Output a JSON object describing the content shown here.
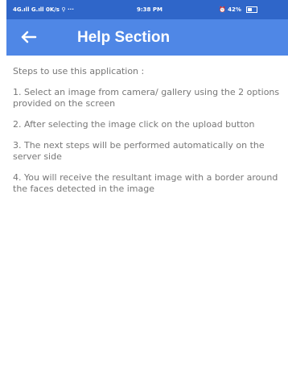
{
  "status_bar": {
    "left": "4G.ıll G.ıll 0K/s ⚲ ··· ",
    "time": "9:38 PM",
    "right": "⏰ 42%"
  },
  "app_bar": {
    "title": "Help Section",
    "back_icon": "arrow-left-icon"
  },
  "content": {
    "intro": "Steps to use this application :",
    "steps": [
      "1. Select an image from camera/ gallery using the 2 options provided on the screen",
      "2. After selecting the image click on the upload button",
      "3. The next steps will be performed automatically on the server side",
      "4. You will receive the resultant image with a border around the faces detected in the image"
    ]
  },
  "colors": {
    "status_bar": "#2f66c9",
    "app_bar": "#4f87e6",
    "text": "#777777",
    "background": "#ffffff"
  }
}
